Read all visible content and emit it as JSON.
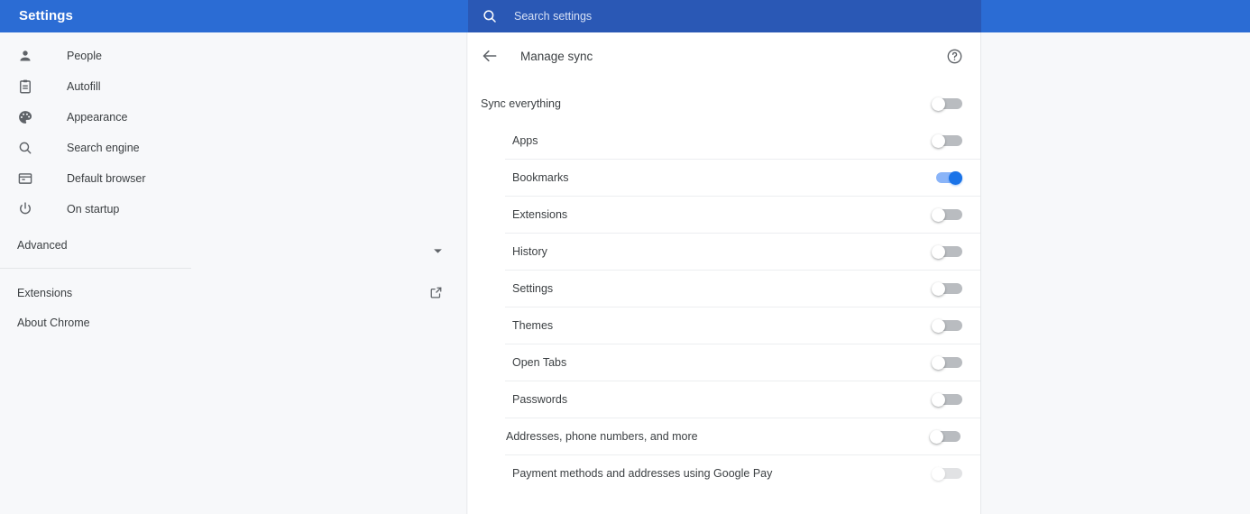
{
  "header": {
    "brand": "Settings",
    "search": {
      "placeholder": "Search settings",
      "value": "",
      "icon": "search-icon"
    },
    "colors": {
      "bar": "#2b6cd4",
      "search_bar": "#2a58b5"
    }
  },
  "sidebar": {
    "items": [
      {
        "label": "People",
        "icon": "person-icon"
      },
      {
        "label": "Autofill",
        "icon": "clipboard-icon"
      },
      {
        "label": "Appearance",
        "icon": "palette-icon"
      },
      {
        "label": "Search engine",
        "icon": "search-icon"
      },
      {
        "label": "Default browser",
        "icon": "browser-window-icon"
      },
      {
        "label": "On startup",
        "icon": "power-icon"
      }
    ],
    "advanced": {
      "label": "Advanced",
      "icon": "chevron-down-icon"
    },
    "footer": [
      {
        "label": "Extensions",
        "icon": "external-link-icon"
      },
      {
        "label": "About Chrome",
        "icon": null
      }
    ]
  },
  "main": {
    "back_icon": "arrow-left-icon",
    "title": "Manage sync",
    "help_icon": "help-circle-icon",
    "sync_everything": {
      "label": "Sync everything",
      "on": false,
      "disabled": false
    },
    "data_types": [
      {
        "label": "Apps",
        "on": false,
        "disabled": false,
        "separator": false
      },
      {
        "label": "Bookmarks",
        "on": true,
        "disabled": false,
        "separator": true
      },
      {
        "label": "Extensions",
        "on": false,
        "disabled": false,
        "separator": true
      },
      {
        "label": "History",
        "on": false,
        "disabled": false,
        "separator": true
      },
      {
        "label": "Settings",
        "on": false,
        "disabled": false,
        "separator": true
      },
      {
        "label": "Themes",
        "on": false,
        "disabled": false,
        "separator": true
      },
      {
        "label": "Open Tabs",
        "on": false,
        "disabled": false,
        "separator": true
      },
      {
        "label": "Passwords",
        "on": false,
        "disabled": false,
        "separator": true
      },
      {
        "label": "Addresses, phone numbers, and more",
        "on": false,
        "disabled": false,
        "separator": true
      },
      {
        "label": "Payment methods and addresses using Google Pay",
        "on": false,
        "disabled": true,
        "separator": true
      }
    ]
  },
  "colors": {
    "accent": "#1a73e8",
    "toggle_on_track": "#8ab4f8",
    "toggle_off_track": "#b9bcc0",
    "page_bg": "#f7f8fa",
    "card_bg": "#ffffff",
    "text": "#3c4043"
  }
}
